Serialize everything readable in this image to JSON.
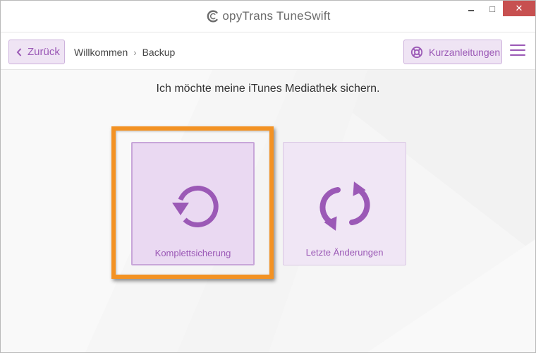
{
  "window": {
    "title": "opyTrans TuneSwift",
    "controls": {
      "minimize": "",
      "maximize": "□",
      "close": "✕"
    }
  },
  "nav": {
    "back_label": "Zurück",
    "breadcrumb": [
      "Willkommen",
      "Backup"
    ],
    "breadcrumb_sep": "›",
    "help_label": "Kurzanleitungen"
  },
  "main": {
    "heading": "Ich möchte meine iTunes Mediathek sichern.",
    "options": [
      {
        "label": "Komplettsicherung",
        "icon": "undo-circle-icon",
        "selected": true
      },
      {
        "label": "Letzte Änderungen",
        "icon": "sync-arrows-icon",
        "selected": false
      }
    ]
  },
  "colors": {
    "accent": "#9b59b6",
    "accent_light": "#efe4f4",
    "highlight": "#f39223",
    "close_red": "#c75050"
  }
}
